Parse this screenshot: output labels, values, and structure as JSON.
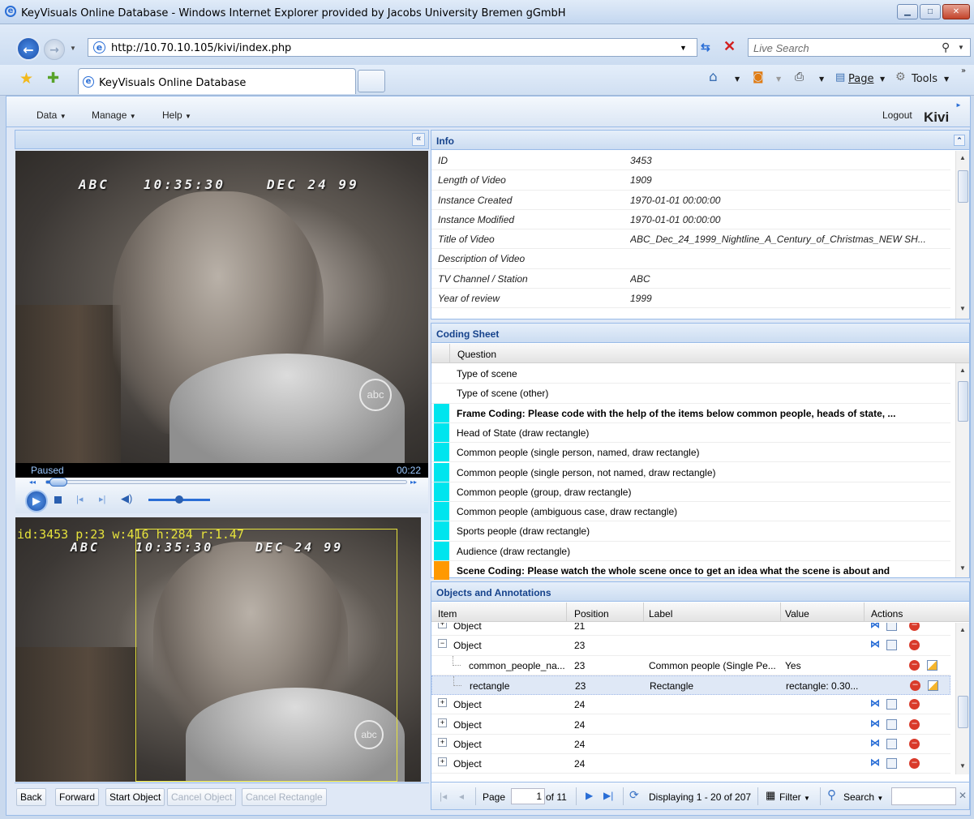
{
  "window": {
    "title": "KeyVisuals Online Database - Windows Internet Explorer provided by Jacobs University Bremen gGmbH",
    "url": "http://10.70.10.105/kivi/index.php",
    "search_placeholder": "Live Search",
    "tab_label": "KeyVisuals Online Database",
    "page_menu": "Page",
    "tools_menu": "Tools"
  },
  "menu": {
    "data": "Data",
    "manage": "Manage",
    "help": "Help",
    "logout": "Logout",
    "brand": "Kivi"
  },
  "video": {
    "overlay_station": "ABC",
    "overlay_time": "10:35:30",
    "overlay_date": "DEC 24 99",
    "logo": "abc",
    "status": "Paused",
    "time": "00:22",
    "annotation_overlay": "id:3453 p:23 w:416 h:284 r:1.47"
  },
  "left_buttons": {
    "back": "Back",
    "forward": "Forward",
    "start_object": "Start Object",
    "cancel_object": "Cancel Object",
    "cancel_rectangle": "Cancel Rectangle"
  },
  "info": {
    "title": "Info",
    "rows": [
      {
        "k": "ID",
        "v": "3453"
      },
      {
        "k": "Length of Video",
        "v": "1909"
      },
      {
        "k": "Instance Created",
        "v": "1970-01-01 00:00:00"
      },
      {
        "k": "Instance Modified",
        "v": "1970-01-01 00:00:00"
      },
      {
        "k": "Title of Video",
        "v": "ABC_Dec_24_1999_Nightline_A_Century_of_Christmas_NEW SH..."
      },
      {
        "k": "Description of Video",
        "v": ""
      },
      {
        "k": "TV Channel / Station",
        "v": "ABC"
      },
      {
        "k": "Year of review",
        "v": "1999"
      }
    ]
  },
  "coding_sheet": {
    "title": "Coding Sheet",
    "column": "Question",
    "rows": [
      {
        "q": "Type of scene",
        "color": "",
        "bold": false
      },
      {
        "q": "Type of scene (other)",
        "color": "",
        "bold": false
      },
      {
        "q": "Frame Coding: Please code with the help of the items below common people, heads of state, ...",
        "color": "#00e5ee",
        "bold": true
      },
      {
        "q": "Head of State (draw rectangle)",
        "color": "#00e5ee",
        "bold": false
      },
      {
        "q": "Common people (single person, named, draw rectangle)",
        "color": "#00e5ee",
        "bold": false
      },
      {
        "q": "Common people (single person, not named, draw rectangle)",
        "color": "#00e5ee",
        "bold": false
      },
      {
        "q": "Common people (group, draw rectangle)",
        "color": "#00e5ee",
        "bold": false
      },
      {
        "q": "Common people (ambiguous case, draw rectangle)",
        "color": "#00e5ee",
        "bold": false
      },
      {
        "q": "Sports people (draw rectangle)",
        "color": "#00e5ee",
        "bold": false
      },
      {
        "q": "Audience (draw rectangle)",
        "color": "#00e5ee",
        "bold": false
      },
      {
        "q": "Scene Coding: Please watch the whole scene once to get an idea what the scene is about and",
        "color": "#ff9900",
        "bold": true
      }
    ]
  },
  "objects": {
    "title": "Objects and Annotations",
    "columns": {
      "item": "Item",
      "position": "Position",
      "label": "Label",
      "value": "Value",
      "actions": "Actions"
    },
    "rows": [
      {
        "item": "Object",
        "position": "21",
        "label": "",
        "value": "",
        "level": 0,
        "expand": "+",
        "actions": "object"
      },
      {
        "item": "Object",
        "position": "23",
        "label": "",
        "value": "",
        "level": 0,
        "expand": "−",
        "actions": "object"
      },
      {
        "item": "common_people_na...",
        "position": "23",
        "label": "Common people (Single Pe...",
        "value": "Yes",
        "level": 1,
        "expand": "",
        "actions": "child"
      },
      {
        "item": "rectangle",
        "position": "23",
        "label": "Rectangle",
        "value": "rectangle: 0.30...",
        "level": 1,
        "expand": "",
        "actions": "child",
        "selected": true
      },
      {
        "item": "Object",
        "position": "24",
        "label": "",
        "value": "",
        "level": 0,
        "expand": "+",
        "actions": "object"
      },
      {
        "item": "Object",
        "position": "24",
        "label": "",
        "value": "",
        "level": 0,
        "expand": "+",
        "actions": "object"
      },
      {
        "item": "Object",
        "position": "24",
        "label": "",
        "value": "",
        "level": 0,
        "expand": "+",
        "actions": "object"
      },
      {
        "item": "Object",
        "position": "24",
        "label": "",
        "value": "",
        "level": 0,
        "expand": "+",
        "actions": "object"
      }
    ]
  },
  "pager": {
    "page_label": "Page",
    "page_value": "1",
    "of_pages": "of 11",
    "displaying": "Displaying 1 - 20 of 207",
    "filter": "Filter",
    "search": "Search"
  },
  "colors": {
    "panel_header": "#15428b",
    "frame_marker": "#00e5ee",
    "scene_marker": "#ff9900",
    "overlay_yellow": "#e6e23c"
  }
}
